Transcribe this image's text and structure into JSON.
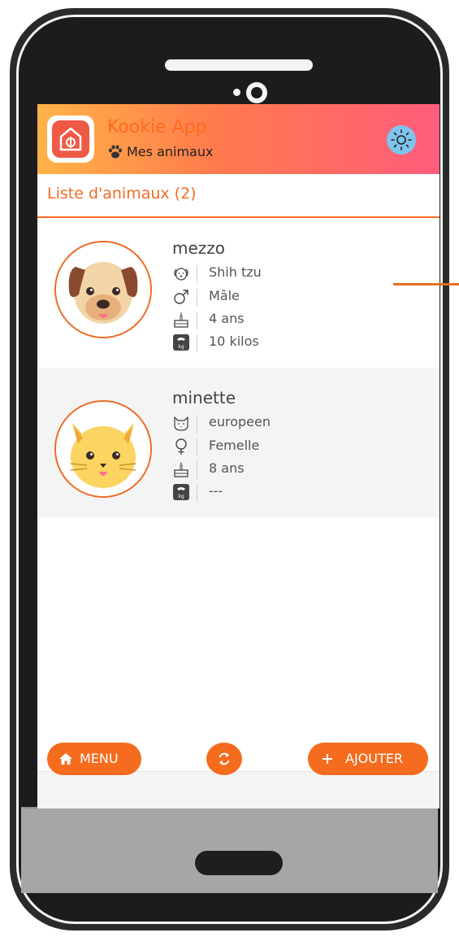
{
  "app": {
    "title": "Kookie App",
    "subtitle": "Mes animaux"
  },
  "list": {
    "title": "Liste d'animaux (2)"
  },
  "pets": [
    {
      "name": "mezzo",
      "breed": "Shih tzu",
      "sex": "Mâle",
      "age": "4 ans",
      "weight": "10 kilos"
    },
    {
      "name": "minette",
      "breed": "europeen",
      "sex": "Femelle",
      "age": "8 ans",
      "weight": "---"
    }
  ],
  "footer": {
    "menu_label": "MENU",
    "add_label": "AJOUTER"
  },
  "colors": {
    "accent": "#f56c1e",
    "header_start": "#ffb347",
    "header_end": "#ff5c7c",
    "theme_button": "#7fc4ec"
  },
  "icons": [
    "home-icon",
    "refresh-icon",
    "plus-icon",
    "sun-icon",
    "paw-icon",
    "dog-icon",
    "cat-icon",
    "male-icon",
    "female-icon",
    "cake-icon",
    "weight-icon"
  ]
}
